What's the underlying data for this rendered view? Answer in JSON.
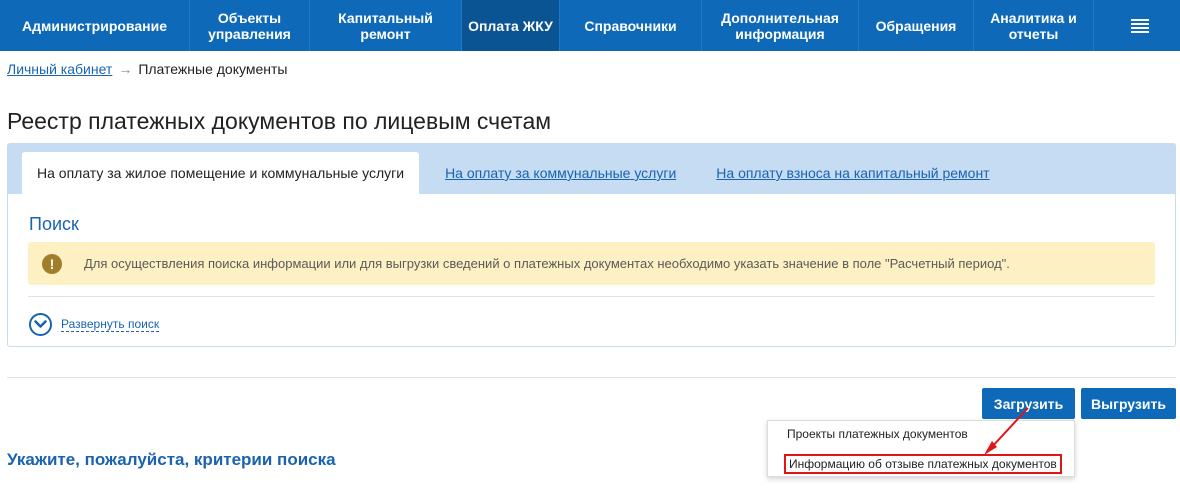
{
  "nav": {
    "items": [
      {
        "label": "Администрирование"
      },
      {
        "label": "Объекты управления"
      },
      {
        "label": "Капитальный ремонт"
      },
      {
        "label": "Оплата ЖКУ"
      },
      {
        "label": "Справочники"
      },
      {
        "label": "Дополнительная информация"
      },
      {
        "label": "Обращения"
      },
      {
        "label": "Аналитика и отчеты"
      }
    ],
    "active_index": 3,
    "menu_icon": "hamburger-icon"
  },
  "breadcrumb": {
    "home": "Личный кабинет",
    "separator": "→",
    "current": "Платежные документы"
  },
  "page_title": "Реестр платежных документов по лицевым счетам",
  "tabs": [
    {
      "label": "На оплату за жилое помещение и коммунальные услуги"
    },
    {
      "label": "На оплату за коммунальные услуги"
    },
    {
      "label": "На оплату взноса на капитальный ремонт"
    }
  ],
  "search": {
    "title": "Поиск",
    "notice": "Для осуществления поиска информации или для выгрузки сведений о платежных документах необходимо указать значение в поле \"Расчетный период\".",
    "notice_icon": "!",
    "expand_label": "Развернуть поиск"
  },
  "buttons": {
    "upload": "Загрузить",
    "download": "Выгрузить"
  },
  "dropdown": {
    "items": [
      "Проекты платежных документов",
      "Информацию об отзыве платежных документов"
    ]
  },
  "criteria_text": "Укажите, пожалуйста, критерии поиска",
  "colors": {
    "nav_bg": "#0e6ab8",
    "nav_active": "#0b5494",
    "link": "#1a63b0",
    "tabbar_bg": "#c5dcf2",
    "notice_bg": "#fdf1c3",
    "highlight": "#e11515"
  }
}
